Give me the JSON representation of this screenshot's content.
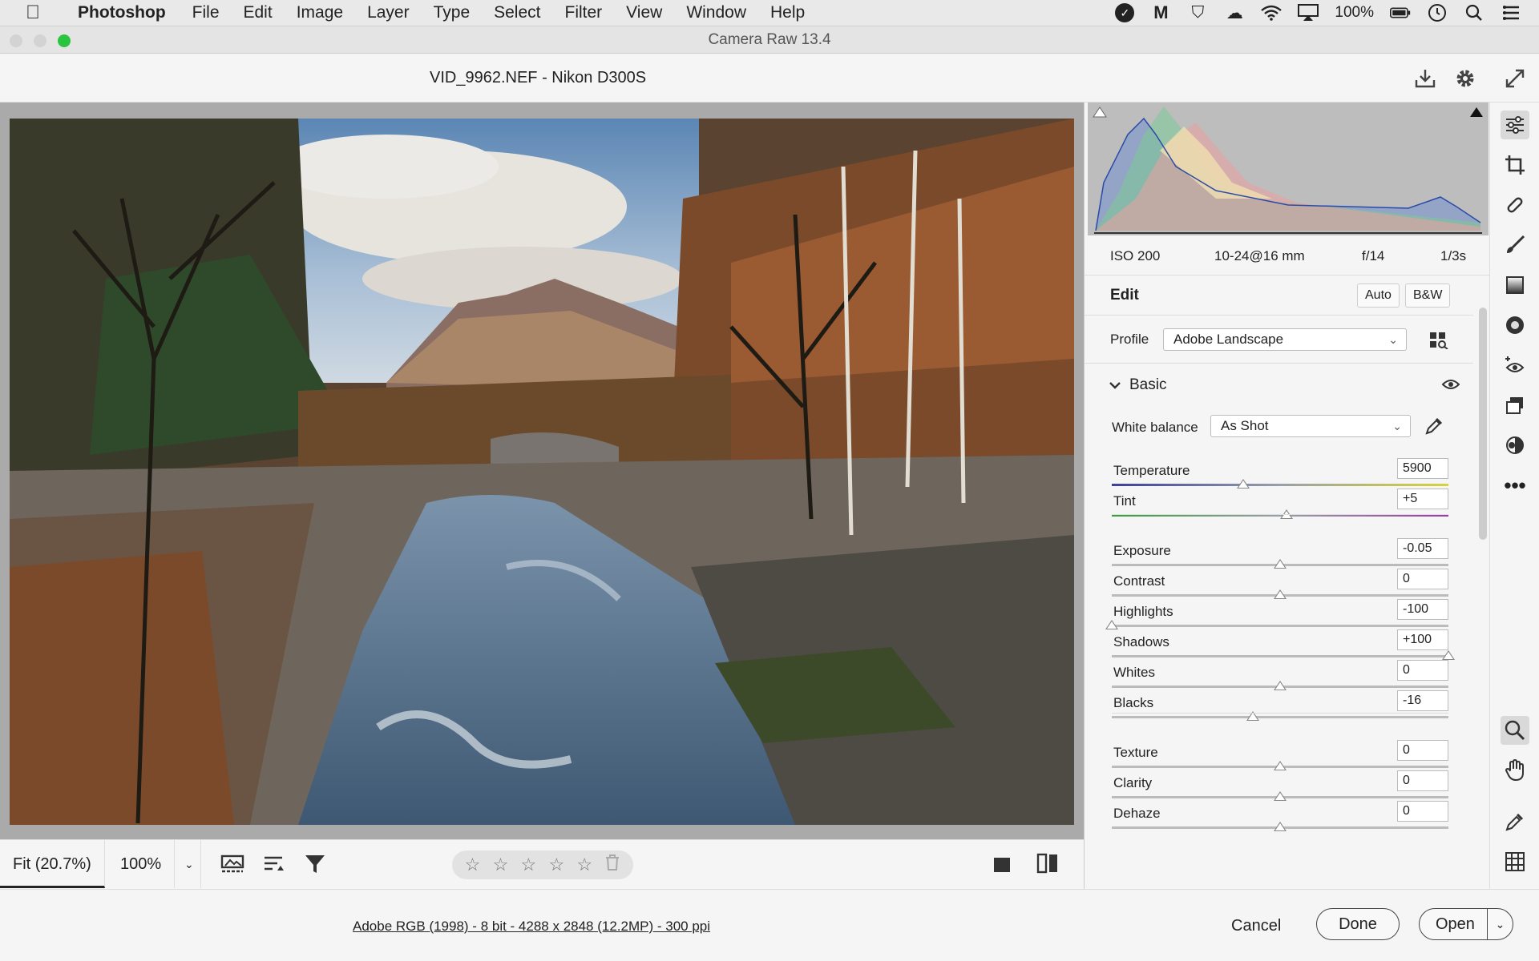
{
  "menubar": {
    "app": "Photoshop",
    "items": [
      "File",
      "Edit",
      "Image",
      "Layer",
      "Type",
      "Select",
      "Filter",
      "View",
      "Window",
      "Help"
    ],
    "battery": "100%"
  },
  "window": {
    "title": "Camera Raw 13.4"
  },
  "toolbar": {
    "file": "VID_9962.NEF  -  Nikon D300S"
  },
  "exif": {
    "iso": "ISO 200",
    "lens": "10-24@16 mm",
    "aperture": "f/14",
    "shutter": "1/3s"
  },
  "edit": {
    "title": "Edit",
    "auto": "Auto",
    "bw": "B&W",
    "profile_label": "Profile",
    "profile_value": "Adobe Landscape",
    "basic": "Basic",
    "wb_label": "White balance",
    "wb_value": "As Shot"
  },
  "sliders": [
    {
      "name": "Temperature",
      "value": "5900",
      "pos": 0.39
    },
    {
      "name": "Tint",
      "value": "+5",
      "pos": 0.52
    },
    {
      "name": "Exposure",
      "value": "-0.05",
      "pos": 0.5
    },
    {
      "name": "Contrast",
      "value": "0",
      "pos": 0.5
    },
    {
      "name": "Highlights",
      "value": "-100",
      "pos": 0.0
    },
    {
      "name": "Shadows",
      "value": "+100",
      "pos": 1.0
    },
    {
      "name": "Whites",
      "value": "0",
      "pos": 0.5
    },
    {
      "name": "Blacks",
      "value": "-16",
      "pos": 0.42
    },
    {
      "name": "Texture",
      "value": "0",
      "pos": 0.5
    },
    {
      "name": "Clarity",
      "value": "0",
      "pos": 0.5
    },
    {
      "name": "Dehaze",
      "value": "0",
      "pos": 0.5
    }
  ],
  "bottom": {
    "fit": "Fit (20.7%)",
    "zoom": "100%"
  },
  "footer": {
    "info": "Adobe RGB (1998) - 8 bit - 4288 x 2848 (12.2MP) - 300 ppi",
    "cancel": "Cancel",
    "done": "Done",
    "open": "Open"
  }
}
